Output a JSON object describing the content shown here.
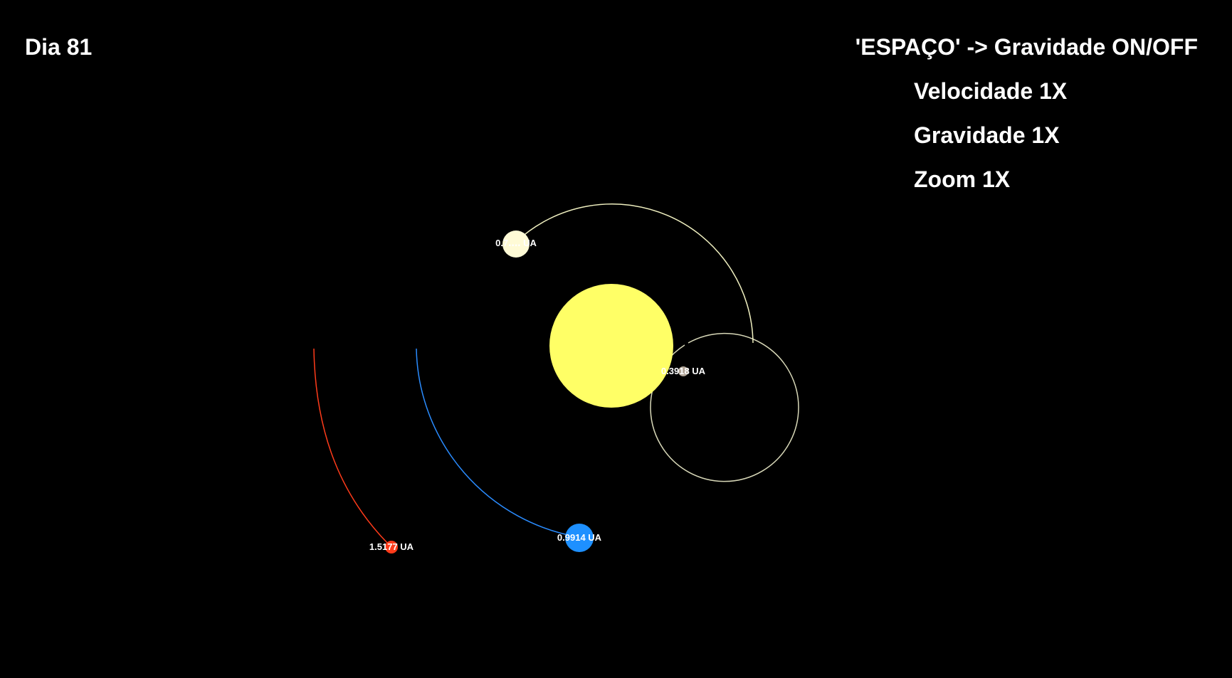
{
  "hud": {
    "day": "Dia 81",
    "gravity_hint": "'ESPAÇO' -> Gravidade ON/OFF",
    "speed": "Velocidade 1X",
    "gravity": "Gravidade 1X",
    "zoom": "Zoom 1X"
  },
  "colors": {
    "background": "#000000",
    "sun": "#ffff66",
    "hud_text": "#ffffff"
  },
  "sun": {
    "name": "sun",
    "color": "#ffff66"
  },
  "planets": [
    {
      "name": "mercury",
      "distance_label": "0.3918 UA",
      "color": "#b4a89a",
      "orbit_color": "#d8d8b8"
    },
    {
      "name": "venus",
      "distance_label": "0.7‥‥ UA",
      "color": "#fffbd6",
      "orbit_color": "#f0f0c0"
    },
    {
      "name": "earth",
      "distance_label": "0.9914 UA",
      "color": "#1e90ff",
      "orbit_color": "#2a8cff"
    },
    {
      "name": "mars",
      "distance_label": "1.5177 UA",
      "color": "#ff3b1a",
      "orbit_color": "#ff3b1a"
    }
  ]
}
